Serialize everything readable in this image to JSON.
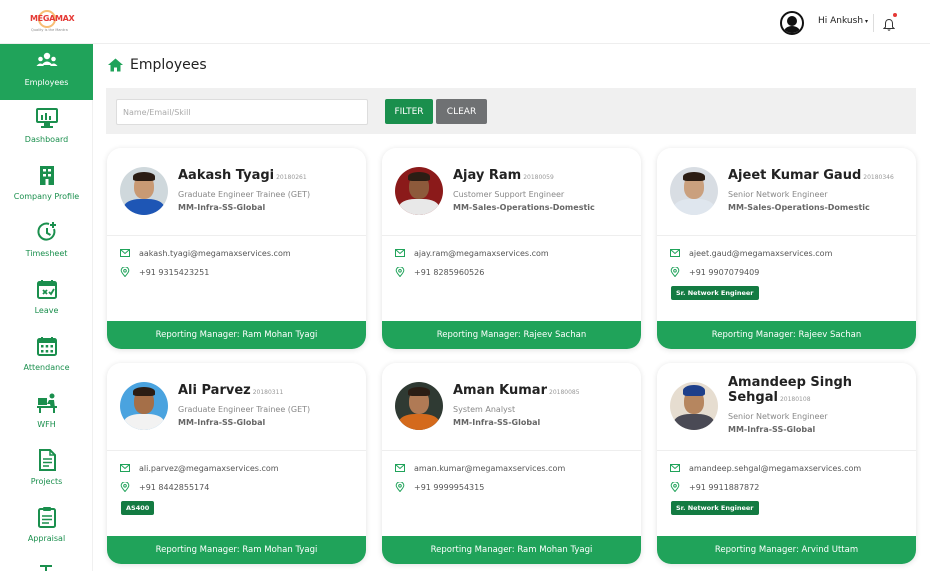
{
  "header": {
    "logo_brand": "MEGAMAX",
    "logo_tagline": "Quality is the Mantra",
    "greeting": "Hi Ankush",
    "caret": "▾"
  },
  "sidebar": {
    "items": [
      {
        "label": "Employees",
        "icon": "employees-icon",
        "active": true
      },
      {
        "label": "Dashboard",
        "icon": "dashboard-icon"
      },
      {
        "label": "Company Profile",
        "icon": "company-profile-icon"
      },
      {
        "label": "Timesheet",
        "icon": "timesheet-icon"
      },
      {
        "label": "Leave",
        "icon": "leave-icon"
      },
      {
        "label": "Attendance",
        "icon": "attendance-icon"
      },
      {
        "label": "WFH",
        "icon": "wfh-icon"
      },
      {
        "label": "Projects",
        "icon": "projects-icon"
      },
      {
        "label": "Appraisal",
        "icon": "appraisal-icon"
      }
    ]
  },
  "page": {
    "title": "Employees"
  },
  "filter": {
    "placeholder": "Name/Email/Skill",
    "filter_label": "FILTER",
    "clear_label": "CLEAR"
  },
  "employees": [
    {
      "name": "Aakash Tyagi",
      "emp_id": "20180261",
      "designation": "Graduate Engineer Trainee (GET)",
      "department": "MM-Infra-SS-Global",
      "email": "aakash.tyagi@megamaxservices.com",
      "phone": "+91 9315423251",
      "skill": "",
      "manager": "Reporting Manager: Ram Mohan Tyagi"
    },
    {
      "name": "Ajay Ram",
      "emp_id": "20180059",
      "designation": "Customer Support Engineer",
      "department": "MM-Sales-Operations-Domestic",
      "email": "ajay.ram@megamaxservices.com",
      "phone": "+91 8285960526",
      "skill": "",
      "manager": "Reporting Manager: Rajeev Sachan"
    },
    {
      "name": "Ajeet Kumar Gaud",
      "emp_id": "20180346",
      "designation": "Senior Network Engineer",
      "department": "MM-Sales-Operations-Domestic",
      "email": "ajeet.gaud@megamaxservices.com",
      "phone": "+91 9907079409",
      "skill": "Sr. Network Engineer",
      "manager": "Reporting Manager: Rajeev Sachan"
    },
    {
      "name": "Ali Parvez",
      "emp_id": "20180311",
      "designation": "Graduate Engineer Trainee (GET)",
      "department": "MM-Infra-SS-Global",
      "email": "ali.parvez@megamaxservices.com",
      "phone": "+91 8442855174",
      "skill": "AS400",
      "manager": "Reporting Manager: Ram Mohan Tyagi"
    },
    {
      "name": "Aman Kumar",
      "emp_id": "20180085",
      "designation": "System Analyst",
      "department": "MM-Infra-SS-Global",
      "email": "aman.kumar@megamaxservices.com",
      "phone": "+91 9999954315",
      "skill": "",
      "manager": "Reporting Manager: Ram Mohan Tyagi"
    },
    {
      "name": "Amandeep Singh Sehgal",
      "emp_id": "20180108",
      "designation": "Senior Network Engineer",
      "department": "MM-Infra-SS-Global",
      "email": "amandeep.sehgal@megamaxservices.com",
      "phone": "+91 9911887872",
      "skill": "Sr. Network Engineer",
      "manager": "Reporting Manager: Arvind Uttam"
    }
  ],
  "colors": {
    "accent": "#20a35a",
    "accent_dark": "#137b42",
    "clear_button": "#6f7173"
  }
}
